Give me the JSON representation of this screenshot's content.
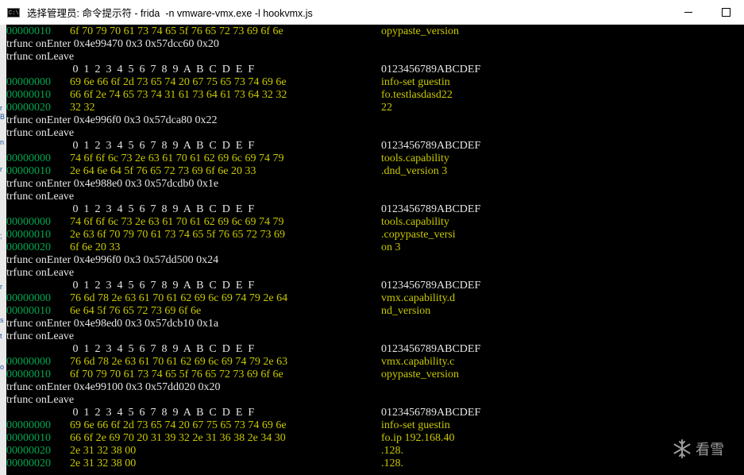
{
  "window": {
    "icon_label": "C:\\",
    "title": "选择管理员: 命令提示符 - frida  -n vmware-vmx.exe -l hookvmx.js",
    "minimize_icon": "minimize-icon",
    "maximize_icon": "maximize-icon"
  },
  "left_strip": [
    "r",
    "B",
    "n",
    "r",
    ";",
    "r",
    "s",
    "t",
    "o"
  ],
  "watermark": {
    "icon": "snowflake-icon",
    "text": "看雪"
  },
  "console": {
    "lines": [
      {
        "type": "row",
        "offset": "00000010",
        "hex": "6f 70 79 70 61 73 74 65 5f 76 65 72 73 69 6f 6e",
        "ascii": "opypaste_version"
      },
      {
        "type": "text",
        "text": "trfunc onEnter 0x4e99470 0x3 0x57dcc60 0x20"
      },
      {
        "type": "text",
        "text": "trfunc onLeave"
      },
      {
        "type": "header",
        "hex": " 0  1  2  3  4  5  6  7  8  9  A  B  C  D  E  F",
        "ascii": "0123456789ABCDEF"
      },
      {
        "type": "row",
        "offset": "00000000",
        "hex": "69 6e 66 6f 2d 73 65 74 20 67 75 65 73 74 69 6e",
        "ascii": "info-set guestin"
      },
      {
        "type": "row",
        "offset": "00000010",
        "hex": "66 6f 2e 74 65 73 74 31 61 73 64 61 73 64 32 32",
        "ascii": "fo.testlasdasd22"
      },
      {
        "type": "row",
        "offset": "00000020",
        "hex": "32 32",
        "ascii": "22"
      },
      {
        "type": "text",
        "text": "trfunc onEnter 0x4e996f0 0x3 0x57dca80 0x22"
      },
      {
        "type": "text",
        "text": "trfunc onLeave"
      },
      {
        "type": "header",
        "hex": " 0  1  2  3  4  5  6  7  8  9  A  B  C  D  E  F",
        "ascii": "0123456789ABCDEF"
      },
      {
        "type": "row",
        "offset": "00000000",
        "hex": "74 6f 6f 6c 73 2e 63 61 70 61 62 69 6c 69 74 79",
        "ascii": "tools.capability"
      },
      {
        "type": "row",
        "offset": "00000010",
        "hex": "2e 64 6e 64 5f 76 65 72 73 69 6f 6e 20 33",
        "ascii": ".dnd_version 3"
      },
      {
        "type": "text",
        "text": "trfunc onEnter 0x4e988e0 0x3 0x57dcdb0 0x1e"
      },
      {
        "type": "text",
        "text": "trfunc onLeave"
      },
      {
        "type": "header",
        "hex": " 0  1  2  3  4  5  6  7  8  9  A  B  C  D  E  F",
        "ascii": "0123456789ABCDEF"
      },
      {
        "type": "row",
        "offset": "00000000",
        "hex": "74 6f 6f 6c 73 2e 63 61 70 61 62 69 6c 69 74 79",
        "ascii": "tools.capability"
      },
      {
        "type": "row",
        "offset": "00000010",
        "hex": "2e 63 6f 70 79 70 61 73 74 65 5f 76 65 72 73 69",
        "ascii": ".copypaste_versi"
      },
      {
        "type": "row",
        "offset": "00000020",
        "hex": "6f 6e 20 33",
        "ascii": "on 3"
      },
      {
        "type": "text",
        "text": "trfunc onEnter 0x4e996f0 0x3 0x57dd500 0x24"
      },
      {
        "type": "text",
        "text": "trfunc onLeave"
      },
      {
        "type": "header",
        "hex": " 0  1  2  3  4  5  6  7  8  9  A  B  C  D  E  F",
        "ascii": "0123456789ABCDEF"
      },
      {
        "type": "row",
        "offset": "00000000",
        "hex": "76 6d 78 2e 63 61 70 61 62 69 6c 69 74 79 2e 64",
        "ascii": "vmx.capability.d"
      },
      {
        "type": "row",
        "offset": "00000010",
        "hex": "6e 64 5f 76 65 72 73 69 6f 6e",
        "ascii": "nd_version"
      },
      {
        "type": "text",
        "text": "trfunc onEnter 0x4e98ed0 0x3 0x57dcb10 0x1a"
      },
      {
        "type": "text",
        "text": "trfunc onLeave"
      },
      {
        "type": "header",
        "hex": " 0  1  2  3  4  5  6  7  8  9  A  B  C  D  E  F",
        "ascii": "0123456789ABCDEF"
      },
      {
        "type": "row",
        "offset": "00000000",
        "hex": "76 6d 78 2e 63 61 70 61 62 69 6c 69 74 79 2e 63",
        "ascii": "vmx.capability.c"
      },
      {
        "type": "row",
        "offset": "00000010",
        "hex": "6f 70 79 70 61 73 74 65 5f 76 65 72 73 69 6f 6e",
        "ascii": "opypaste_version"
      },
      {
        "type": "text",
        "text": "trfunc onEnter 0x4e99100 0x3 0x57dd020 0x20"
      },
      {
        "type": "text",
        "text": "trfunc onLeave"
      },
      {
        "type": "header",
        "hex": " 0  1  2  3  4  5  6  7  8  9  A  B  C  D  E  F",
        "ascii": "0123456789ABCDEF"
      },
      {
        "type": "row",
        "offset": "00000000",
        "hex": "69 6e 66 6f 2d 73 65 74 20 67 75 65 73 74 69 6e",
        "ascii": "info-set guestin"
      },
      {
        "type": "row",
        "offset": "00000010",
        "hex": "66 6f 2e 69 70 20 31 39 32 2e 31 36 38 2e 34 30",
        "ascii": "fo.ip 192.168.40"
      },
      {
        "type": "row",
        "offset": "00000020",
        "hex": "2e 31 32 38 00",
        "ascii": ".128."
      },
      {
        "type": "row",
        "offset": "00000020",
        "hex": "2e 31 32 38 00",
        "ascii": ".128."
      }
    ]
  }
}
